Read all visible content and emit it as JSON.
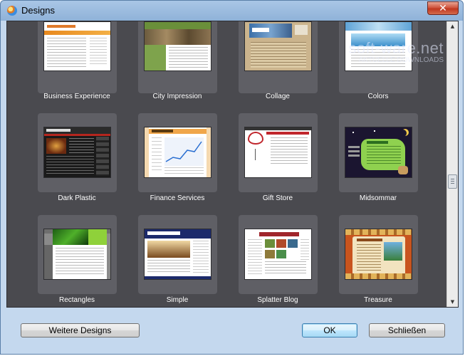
{
  "window": {
    "title": "Designs",
    "close_glyph": "✕"
  },
  "watermark": {
    "main": "soft-ware.net",
    "sub": "AKTUELLE DOWNLOADS"
  },
  "designs": [
    {
      "name": "Business Experience"
    },
    {
      "name": "City Impression"
    },
    {
      "name": "Collage"
    },
    {
      "name": "Colors"
    },
    {
      "name": "Dark Plastic"
    },
    {
      "name": "Finance Services"
    },
    {
      "name": "Gift Store"
    },
    {
      "name": "Midsommar"
    },
    {
      "name": "Rectangles"
    },
    {
      "name": "Simple"
    },
    {
      "name": "Splatter Blog"
    },
    {
      "name": "Treasure"
    }
  ],
  "footer": {
    "more_designs": "Weitere Designs",
    "ok": "OK",
    "close": "Schließen"
  },
  "scroll": {
    "up": "▲",
    "down": "▼"
  }
}
